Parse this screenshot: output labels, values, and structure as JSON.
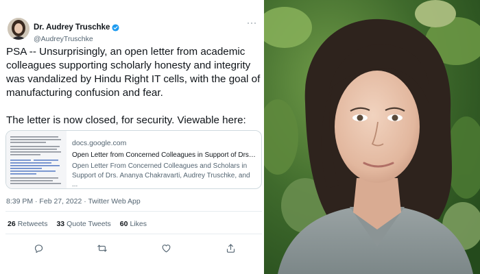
{
  "tweet": {
    "display_name": "Dr. Audrey Truschke",
    "handle": "@AudreyTruschke",
    "paragraph_1": "PSA -- Unsurprisingly, an open letter from academic colleagues supporting scholarly honesty and integrity was vandalized by Hindu Right IT cells, with the goal of manufacturing confusion and fear.",
    "paragraph_2": "The letter is now closed, for security. Viewable here:",
    "timestamp": "8:39 PM · Feb 27, 2022 · Twitter Web App"
  },
  "link_card": {
    "domain": "docs.google.com",
    "title": "Open Letter from Concerned Colleagues in Support of Drs. ...",
    "description": "Open Letter From Concerned Colleagues and Scholars in Support of Drs. Ananya Chakravarti, Audrey Truschke, and ..."
  },
  "stats": {
    "retweets_count": "26",
    "retweets_label": "Retweets",
    "quote_count": "33",
    "quote_label": "Quote Tweets",
    "likes_count": "60",
    "likes_label": "Likes"
  },
  "icons": {
    "verified": "verified-badge-icon",
    "more": "more-options-icon",
    "reply": "reply-icon",
    "retweet": "retweet-icon",
    "like": "heart-icon",
    "share": "share-icon"
  },
  "colors": {
    "verified": "#1d9bf0",
    "secondary_text": "#536471",
    "primary_text": "#0f1419",
    "border": "#cfd9de"
  }
}
